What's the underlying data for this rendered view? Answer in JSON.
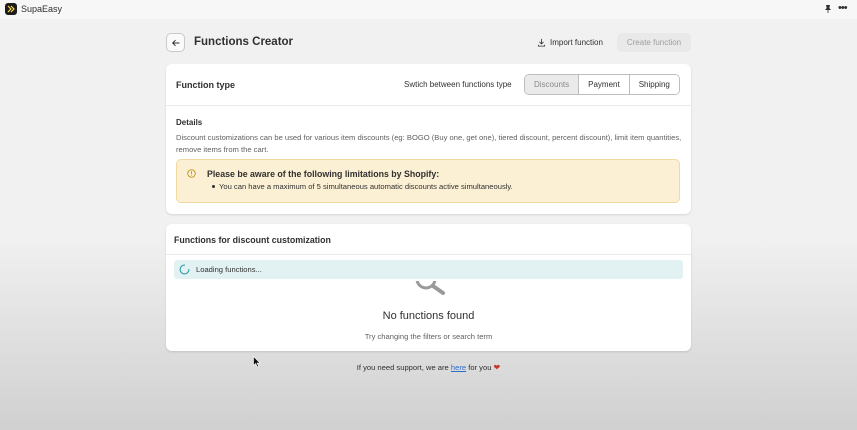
{
  "app": {
    "name": "SupaEasy",
    "logo_icon": "supaeasy-logo-icon",
    "pin_icon": "pin-icon",
    "more_icon": "more-horizontal-icon"
  },
  "header": {
    "back_icon": "arrow-left-icon",
    "title": "Functions Creator",
    "import_label": "Import function",
    "import_icon": "download-icon",
    "create_label": "Create function"
  },
  "function_type": {
    "title": "Function type",
    "switch_label": "Swtich between functions type",
    "options": [
      "Discounts",
      "Payment",
      "Shipping"
    ],
    "selected": "Discounts"
  },
  "details": {
    "title": "Details",
    "text": "Discount customizations can be used for various item discounts (eg: BOGO (Buy one, get one), tiered discount, percent discount), limit item quantities, remove items from the cart."
  },
  "banner": {
    "icon": "warning-circle-icon",
    "title": "Please be aware of the following limitations by Shopify:",
    "items": [
      "You can have a maximum of 5 simultaneous automatic discounts active simultaneously."
    ]
  },
  "functions_list": {
    "title": "Functions for discount customization",
    "loading_text": "Loading functions...",
    "empty_title": "No functions found",
    "empty_subtitle": "Try changing the filters or search term"
  },
  "footer": {
    "prefix": "If you need support, we are ",
    "link_text": "here",
    "suffix": " for you ",
    "heart": "❤"
  },
  "colors": {
    "banner_bg": "#fcf0d4",
    "loading_bg": "#e2f2f3",
    "link": "#2c6ecb",
    "heart": "#c9372c"
  }
}
